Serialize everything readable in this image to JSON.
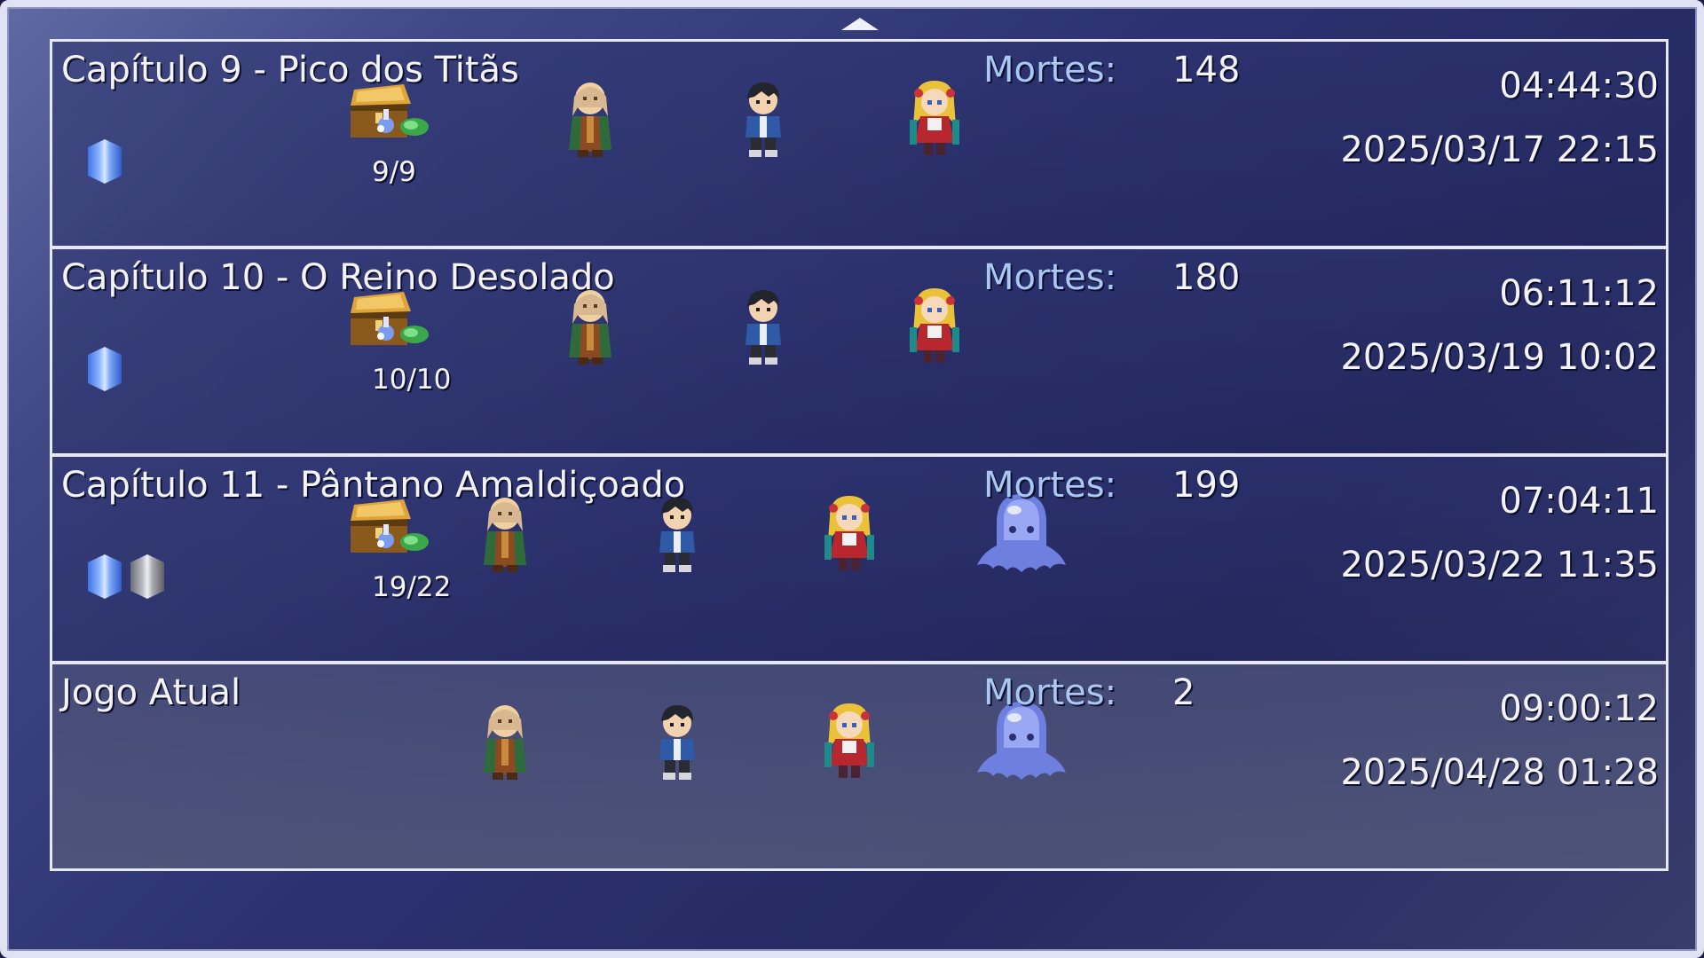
{
  "window": {
    "scroll_up_icon": "triangle-up-icon"
  },
  "save_slots": [
    {
      "title": "Capítulo 9 - Pico dos Titãs",
      "deaths_label": "Mortes:",
      "deaths_value": "148",
      "time": "04:44:30",
      "date": "2025/03/17 22:15",
      "chests": "9/9",
      "gems": [
        "blue"
      ],
      "party": [
        "bald-sage-sprite",
        "dark-haired-boy-sprite",
        "blonde-girl-sprite"
      ]
    },
    {
      "title": "Capítulo 10 - O Reino Desolado",
      "deaths_label": "Mortes:",
      "deaths_value": "180",
      "time": "06:11:12",
      "date": "2025/03/19 10:02",
      "chests": "10/10",
      "gems": [
        "blue"
      ],
      "party": [
        "bald-sage-sprite",
        "dark-haired-boy-sprite",
        "blonde-girl-sprite"
      ]
    },
    {
      "title": "Capítulo 11 - Pântano Amaldiçoado",
      "deaths_label": "Mortes:",
      "deaths_value": "199",
      "time": "07:04:11",
      "date": "2025/03/22 11:35",
      "chests": "19/22",
      "gems": [
        "blue",
        "gray"
      ],
      "party": [
        "bald-sage-sprite",
        "dark-haired-boy-sprite",
        "blonde-girl-sprite",
        "slime-sprite"
      ]
    },
    {
      "title": "Jogo Atual",
      "deaths_label": "Mortes:",
      "deaths_value": "2",
      "time": "09:00:12",
      "date": "2025/04/28 01:28",
      "chests": "",
      "gems": [],
      "party": [
        "bald-sage-sprite",
        "dark-haired-boy-sprite",
        "blonde-girl-sprite",
        "slime-sprite"
      ]
    }
  ]
}
